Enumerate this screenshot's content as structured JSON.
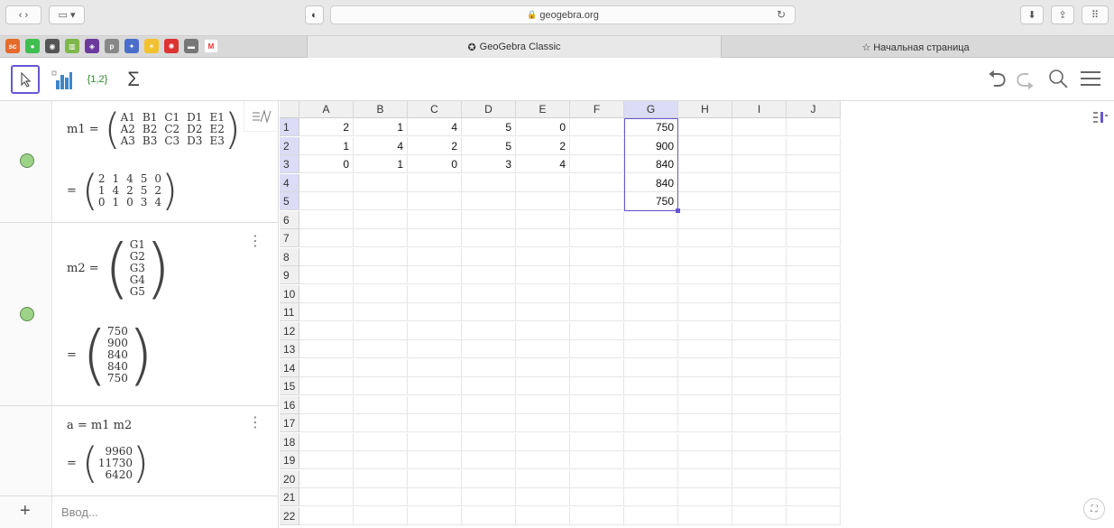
{
  "browser": {
    "url": "geogebra.org",
    "tabs": [
      {
        "label": "GeoGebra Classic",
        "active": true
      },
      {
        "label": "☆ Начальная страница",
        "active": false
      }
    ]
  },
  "toolbar": {
    "tools": [
      "move-tool",
      "chart-tool",
      "list-tool",
      "sum-tool"
    ],
    "list_label": "{1,2}",
    "sum_label": "Σ"
  },
  "algebra": {
    "m1": {
      "definition": "m1 =",
      "rows": [
        [
          "A1",
          "B1",
          "C1",
          "D1",
          "E1"
        ],
        [
          "A2",
          "B2",
          "C2",
          "D2",
          "E2"
        ],
        [
          "A3",
          "B3",
          "C3",
          "D3",
          "E3"
        ]
      ],
      "values": [
        [
          "2",
          "1",
          "4",
          "5",
          "0"
        ],
        [
          "1",
          "4",
          "2",
          "5",
          "2"
        ],
        [
          "0",
          "1",
          "0",
          "3",
          "4"
        ]
      ]
    },
    "m2": {
      "definition": "m2 =",
      "rows": [
        "G1",
        "G2",
        "G3",
        "G4",
        "G5"
      ],
      "values": [
        "750",
        "900",
        "840",
        "840",
        "750"
      ]
    },
    "a": {
      "definition": "a = m1 m2",
      "values": [
        "9960",
        "11730",
        "6420"
      ]
    },
    "equals": "=",
    "input_placeholder": "Ввод..."
  },
  "spreadsheet": {
    "columns": [
      "A",
      "B",
      "C",
      "D",
      "E",
      "F",
      "G",
      "H",
      "I",
      "J"
    ],
    "rows": [
      "1",
      "2",
      "3",
      "4",
      "5",
      "6",
      "7",
      "8",
      "9",
      "10",
      "11",
      "12",
      "13",
      "14",
      "15",
      "16",
      "17",
      "18",
      "19",
      "20",
      "21",
      "22"
    ],
    "cells": {
      "A1": "2",
      "B1": "1",
      "C1": "4",
      "D1": "5",
      "E1": "0",
      "G1": "750",
      "A2": "1",
      "B2": "4",
      "C2": "2",
      "D2": "5",
      "E2": "2",
      "G2": "900",
      "A3": "0",
      "B3": "1",
      "C3": "0",
      "D3": "3",
      "E3": "4",
      "G3": "840",
      "G4": "840",
      "G5": "750"
    },
    "selection": "G1:G5"
  },
  "colors": {
    "accent": "#6557d2",
    "point": "#9cd386"
  }
}
